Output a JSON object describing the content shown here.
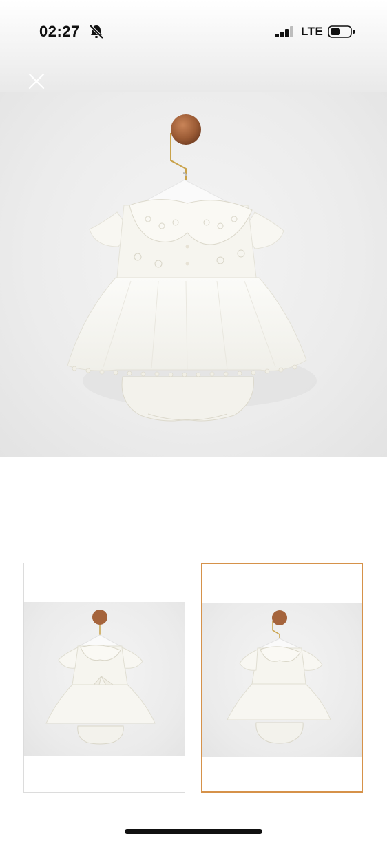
{
  "status_bar": {
    "time": "02:27",
    "network": "LTE",
    "icons": [
      "bell-slash-icon",
      "signal-icon",
      "battery-icon"
    ]
  },
  "viewer": {
    "close_icon": "close-icon",
    "selected_thumbnail_index": 1,
    "thumbnails_count": 2
  },
  "colors": {
    "selected_border": "#d6924a",
    "background": "#ffffff",
    "photo_background": "#ececec"
  }
}
